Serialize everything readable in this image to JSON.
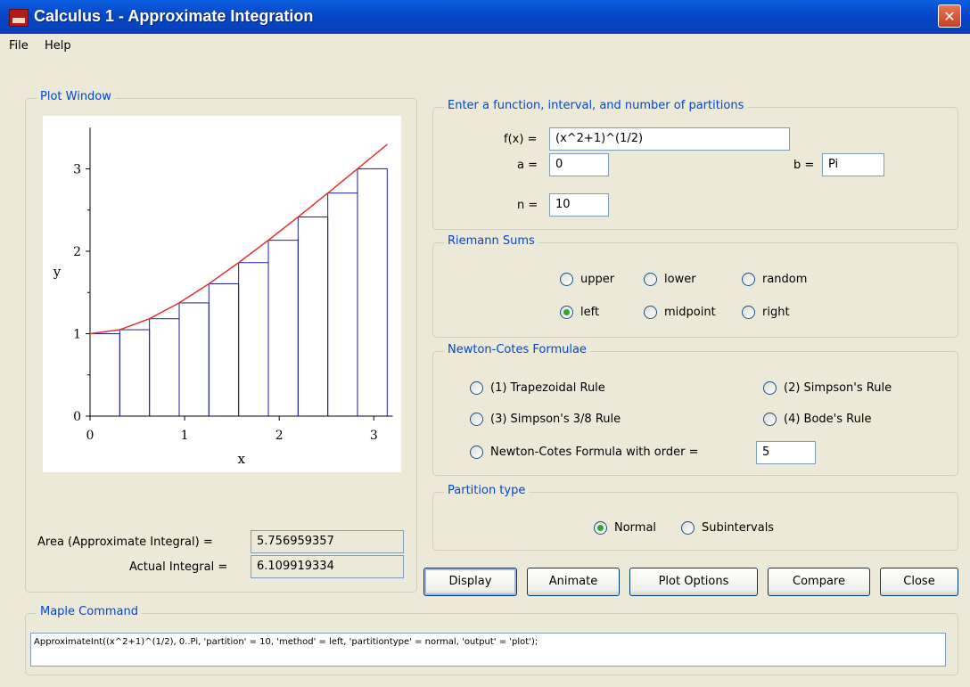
{
  "window": {
    "title": "Calculus 1 - Approximate Integration",
    "close_glyph": "✕"
  },
  "menu": {
    "items": [
      "File",
      "Help"
    ]
  },
  "plot_window": {
    "legend": "Plot Window",
    "area_label": "Area (Approximate Integral) =",
    "area_value": "5.756959357",
    "actual_label": "Actual Integral =",
    "actual_value": "6.109919334"
  },
  "chart_data": {
    "type": "bar",
    "xlabel": "x",
    "ylabel": "y",
    "xlim": [
      0,
      3.1416
    ],
    "ylim": [
      0,
      3.5
    ],
    "x_ticks": [
      "0",
      "1",
      "2",
      "3"
    ],
    "y_ticks": [
      "0",
      "1",
      "2",
      "3"
    ],
    "curve": {
      "name": "f(x)",
      "color": "#e8302b",
      "x": [
        0,
        0.3142,
        0.6283,
        0.9425,
        1.2566,
        1.5708,
        1.885,
        2.1991,
        2.5133,
        2.8274,
        3.1416
      ],
      "y": [
        1.0,
        1.0482,
        1.1816,
        1.3739,
        1.6058,
        1.8621,
        2.134,
        2.4165,
        2.7061,
        3.0008,
        3.2969
      ]
    },
    "bars": {
      "name": "left Riemann sum",
      "color": "#1f1f9e",
      "x_left": [
        0,
        0.3142,
        0.6283,
        0.9425,
        1.2566,
        1.5708,
        1.885,
        2.1991,
        2.5133,
        2.8274
      ],
      "width": 0.3142,
      "heights": [
        1.0,
        1.0482,
        1.1816,
        1.3739,
        1.6058,
        1.8621,
        2.134,
        2.4165,
        2.7061,
        3.0008
      ]
    }
  },
  "input": {
    "legend": "Enter a function, interval, and number of partitions",
    "fx_label": "f(x) =",
    "fx_value": "(x^2+1)^(1/2)",
    "a_label": "a =",
    "a_value": "0",
    "b_label": "b =",
    "b_value": "Pi",
    "n_label": "n =",
    "n_value": "10"
  },
  "riemann": {
    "legend": "Riemann Sums",
    "options": [
      {
        "label": "upper",
        "selected": false
      },
      {
        "label": "lower",
        "selected": false
      },
      {
        "label": "random",
        "selected": false
      },
      {
        "label": "left",
        "selected": true
      },
      {
        "label": "midpoint",
        "selected": false
      },
      {
        "label": "right",
        "selected": false
      }
    ]
  },
  "newton_cotes": {
    "legend": "Newton-Cotes Formulae",
    "options": [
      {
        "label": "(1) Trapezoidal Rule",
        "selected": false
      },
      {
        "label": "(2) Simpson's Rule",
        "selected": false
      },
      {
        "label": "(3) Simpson's 3/8 Rule",
        "selected": false
      },
      {
        "label": "(4) Bode's Rule",
        "selected": false
      },
      {
        "label": "Newton-Cotes Formula with order =",
        "selected": false
      }
    ],
    "order_value": "5"
  },
  "partition": {
    "legend": "Partition type",
    "options": [
      {
        "label": "Normal",
        "selected": true
      },
      {
        "label": "Subintervals",
        "selected": false
      }
    ]
  },
  "buttons": {
    "display": "Display",
    "animate": "Animate",
    "plot_options": "Plot Options",
    "compare": "Compare",
    "close": "Close"
  },
  "maple": {
    "legend": "Maple Command",
    "command": "ApproximateInt((x^2+1)^(1/2), 0..Pi, 'partition' = 10, 'method' = left, 'partitiontype' = normal, 'output' = 'plot');"
  }
}
